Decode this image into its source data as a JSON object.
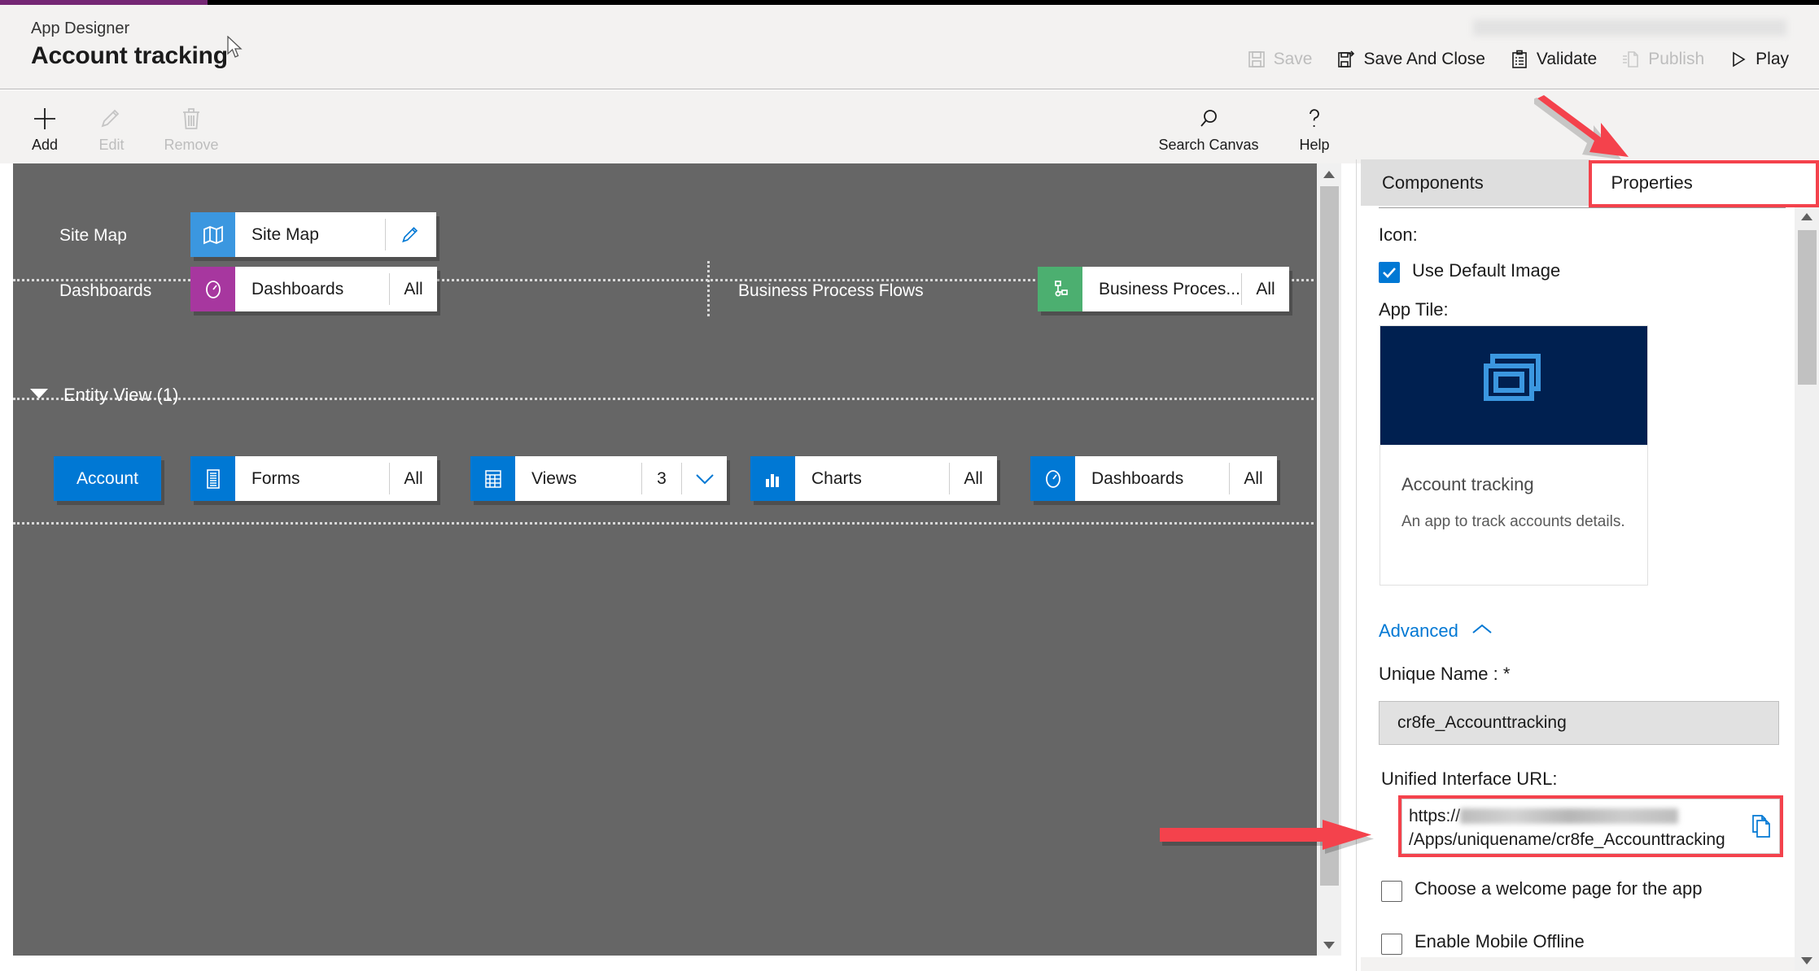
{
  "header": {
    "breadcrumb": "App Designer",
    "title": "Account tracking",
    "redacted_label": "",
    "actions": [
      {
        "label": "Save",
        "icon": "save-icon",
        "enabled": false
      },
      {
        "label": "Save And Close",
        "icon": "save-and-close-icon",
        "enabled": true
      },
      {
        "label": "Validate",
        "icon": "validate-icon",
        "enabled": true
      },
      {
        "label": "Publish",
        "icon": "publish-icon",
        "enabled": false
      },
      {
        "label": "Play",
        "icon": "play-icon",
        "enabled": true
      }
    ]
  },
  "commandbar": {
    "add": "Add",
    "edit": "Edit",
    "remove": "Remove",
    "search_canvas": "Search Canvas",
    "help": "Help"
  },
  "canvas": {
    "rows": [
      {
        "label": "Site Map"
      },
      {
        "label": "Dashboards"
      },
      {
        "label": "Business Process Flows"
      }
    ],
    "sitemap_chip": {
      "name": "Site Map",
      "icon": "map-icon",
      "color": "#3b97e0"
    },
    "dashboards_chip": {
      "name": "Dashboards",
      "count": "All",
      "icon": "gauge-icon",
      "color": "#a7379f"
    },
    "bpf_chip": {
      "name": "Business Proces...",
      "count": "All",
      "icon": "process-flow-icon",
      "color": "#4caf70"
    },
    "entity_view": {
      "caption": "Entity View (1)",
      "entity_button": "Account",
      "chips": [
        {
          "name": "Forms",
          "count": "All",
          "icon": "form-icon",
          "color": "#0078d4"
        },
        {
          "name": "Views",
          "count": "3",
          "icon": "grid-icon",
          "color": "#0078d4"
        },
        {
          "name": "Charts",
          "count": "All",
          "icon": "bar-chart-icon",
          "color": "#0078d4"
        },
        {
          "name": "Dashboards",
          "count": "All",
          "icon": "gauge-icon",
          "color": "#0078d4"
        }
      ]
    }
  },
  "panel": {
    "tabs": [
      {
        "label": "Components",
        "active": false
      },
      {
        "label": "Properties",
        "active": true
      }
    ],
    "icon_label": "Icon:",
    "use_default_image": {
      "label": "Use Default Image",
      "checked": true
    },
    "app_tile_label": "App Tile:",
    "app_tile": {
      "name": "Account tracking",
      "description": "An app to track accounts details."
    },
    "advanced": {
      "label": "Advanced",
      "expanded": true
    },
    "unique_name": {
      "label": "Unique Name : *",
      "value": "cr8fe_Accounttracking"
    },
    "unified_url": {
      "label": "Unified Interface URL:",
      "prefix": "https://",
      "redacted": "",
      "suffix": "/Apps/uniquename/cr8fe_Accounttracking",
      "copy_icon": "copy-icon"
    },
    "welcome_page": {
      "label": "Choose a welcome page for the app",
      "checked": false
    },
    "mobile_offline": {
      "label": "Enable Mobile Offline",
      "checked": false
    }
  },
  "annotations": {
    "properties_highlight": "red-box-properties-tab",
    "url_highlight": "red-box-unified-url",
    "arrow_properties": "red-arrow-to-properties-tab",
    "arrow_url": "red-arrow-to-url"
  },
  "colors": {
    "accent": "#0078d4",
    "annotation": "#f4424c",
    "canvas_bg": "#666666",
    "chrome_bg": "#f3f2f1",
    "tile_banner": "#002050"
  }
}
